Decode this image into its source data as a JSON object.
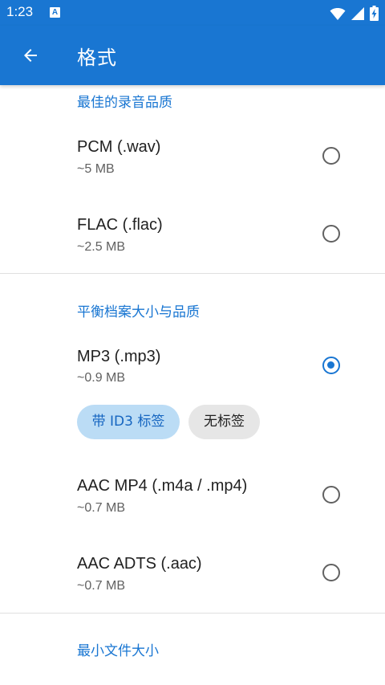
{
  "status_bar": {
    "time": "1:23",
    "notification_letter": "A",
    "icons": [
      "wifi-icon",
      "signal-icon",
      "battery-charging-icon"
    ]
  },
  "app_bar": {
    "back_icon": "arrow-left-icon",
    "title": "格式"
  },
  "sections": [
    {
      "header": "最佳的录音品质",
      "items": [
        {
          "title": "PCM (.wav)",
          "subtitle": "~5 MB",
          "selected": false
        },
        {
          "title": "FLAC (.flac)",
          "subtitle": "~2.5 MB",
          "selected": false
        }
      ]
    },
    {
      "header": "平衡档案大小与品质",
      "items": [
        {
          "title": "MP3 (.mp3)",
          "subtitle": "~0.9 MB",
          "selected": true
        },
        {
          "title": "AAC MP4 (.m4a / .mp4)",
          "subtitle": "~0.7 MB",
          "selected": false
        },
        {
          "title": "AAC ADTS (.aac)",
          "subtitle": "~0.7 MB",
          "selected": false
        }
      ],
      "chips": [
        {
          "label": "带 ID3 标签",
          "selected": true
        },
        {
          "label": "无标签",
          "selected": false
        }
      ]
    },
    {
      "header": "最小文件大小",
      "items": []
    }
  ],
  "colors": {
    "primary": "#1976d2",
    "chip_selected_bg": "#bbdcf5",
    "chip_bg": "#e6e6e6"
  }
}
